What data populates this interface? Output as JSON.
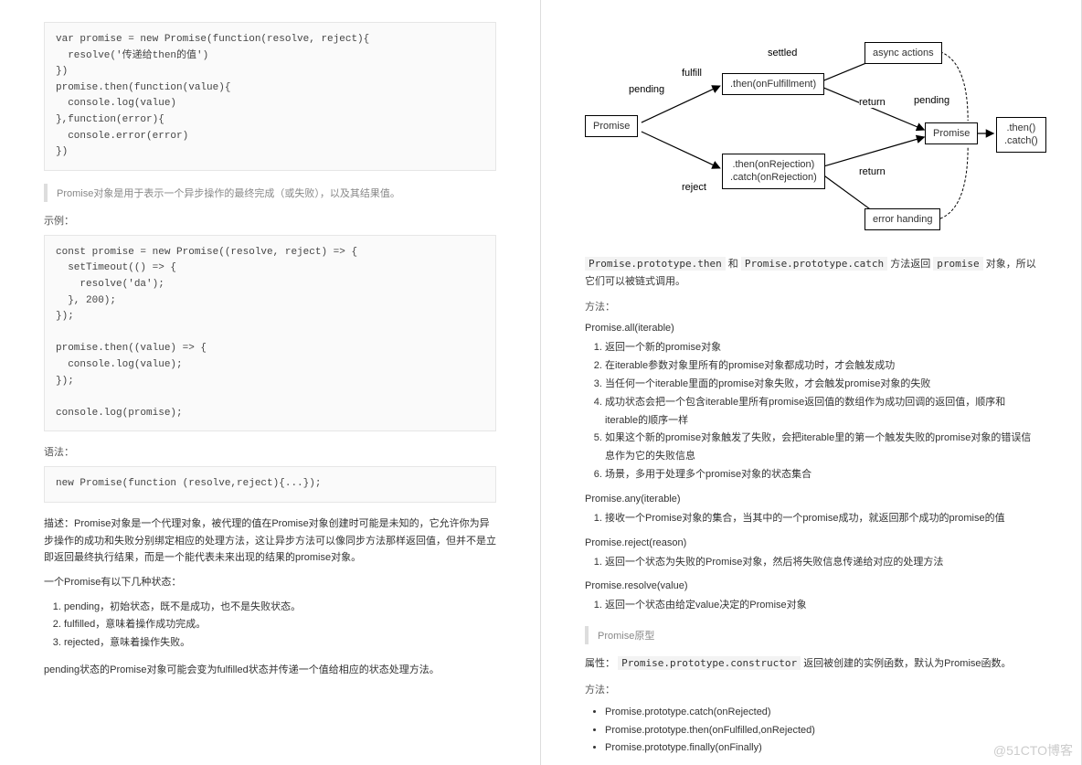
{
  "left": {
    "code1": "var promise = new Promise(function(resolve, reject){\n  resolve('传递给then的值')\n})\npromise.then(function(value){\n  console.log(value)\n},function(error){\n  console.error(error)\n})",
    "quote1": "Promise对象是用于表示一个异步操作的最终完成（或失败），以及其结果值。",
    "example_label": "示例：",
    "code2": "const promise = new Promise((resolve, reject) => {\n  setTimeout(() => {\n    resolve('da');\n  }, 200);\n});\n\npromise.then((value) => {\n  console.log(value);\n});\n\nconsole.log(promise);",
    "syntax_label": "语法：",
    "code3": "new Promise(function (resolve,reject){...});",
    "desc": "描述：Promise对象是一个代理对象，被代理的值在Promise对象创建时可能是未知的，它允许你为异步操作的成功和失败分别绑定相应的处理方法，这让异步方法可以像同步方法那样返回值，但并不是立即返回最终执行结果，而是一个能代表未来出现的结果的promise对象。",
    "states_intro": "一个Promise有以下几种状态：",
    "states": [
      "pending，初始状态，既不是成功，也不是失败状态。",
      "fulfilled，意味着操作成功完成。",
      "rejected，意味着操作失败。"
    ],
    "pending_note": "pending状态的Promise对象可能会变为fulfilled状态并传递一个值给相应的状态处理方法。"
  },
  "right": {
    "diagram": {
      "promise": "Promise",
      "pending1": "pending",
      "fulfill": "fulfill",
      "reject": "reject",
      "settled": "settled",
      "then_fulfill": ".then(onFulfillment)",
      "then_reject": ".then(onRejection)\n.catch(onRejection)",
      "async_actions": "async actions",
      "error_handing": "error handing",
      "return1": "return",
      "return2": "return",
      "pending2": "pending",
      "promise2": "Promise",
      "then_catch": ".then()\n.catch()"
    },
    "chain_note_pre": "Promise.prototype.then",
    "chain_note_mid": "和",
    "chain_note_code2": "Promise.prototype.catch",
    "chain_note_mid2": "方法返回",
    "chain_note_code3": "promise",
    "chain_note_post": "对象，所以它们可以被链式调用。",
    "methods_label": "方法：",
    "all_title": "Promise.all(iterable)",
    "all_items": [
      "返回一个新的promise对象",
      "在iterable参数对象里所有的promise对象都成功时，才会触发成功",
      "当任何一个iterable里面的promise对象失败，才会触发promise对象的失败",
      "成功状态会把一个包含iterable里所有promise返回值的数组作为成功回调的返回值，顺序和iterable的顺序一样",
      "如果这个新的promise对象触发了失败，会把iterable里的第一个触发失败的promise对象的错误信息作为它的失败信息",
      "场景，多用于处理多个promise对象的状态集合"
    ],
    "any_title": "Promise.any(iterable)",
    "any_items": [
      "接收一个Promise对象的集合，当其中的一个promise成功，就返回那个成功的promise的值"
    ],
    "reject_title": "Promise.reject(reason)",
    "reject_items": [
      "返回一个状态为失败的Promise对象，然后将失败信息传递给对应的处理方法"
    ],
    "resolve_title": "Promise.resolve(value)",
    "resolve_items": [
      "返回一个状态由给定value决定的Promise对象"
    ],
    "proto_quote": "Promise原型",
    "attr_label": "属性：",
    "attr_code": "Promise.prototype.constructor",
    "attr_post": "返回被创建的实例函数，默认为Promise函数。",
    "methods2_label": "方法：",
    "proto_methods": [
      "Promise.prototype.catch(onRejected)",
      "Promise.prototype.then(onFulfilled,onRejected)",
      "Promise.prototype.finally(onFinally)"
    ]
  },
  "watermark": "@51CTO博客"
}
